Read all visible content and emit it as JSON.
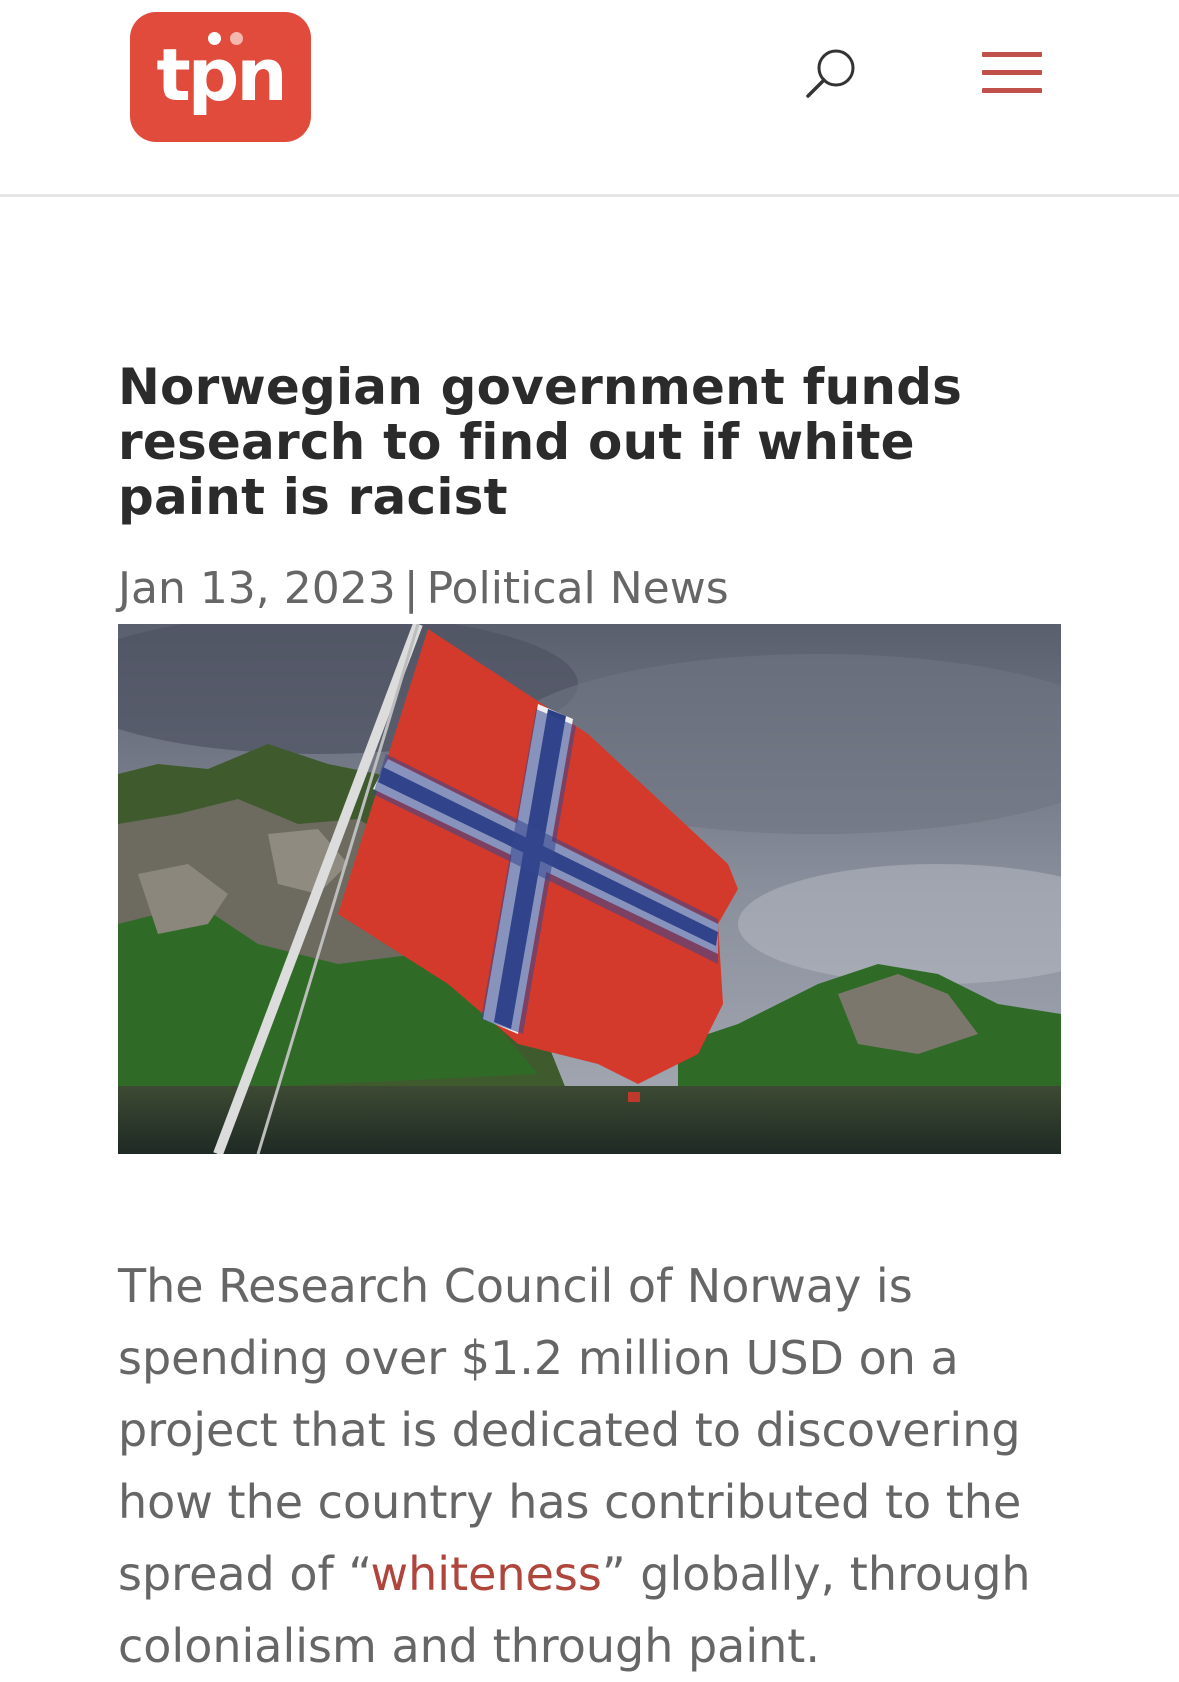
{
  "header": {
    "logo_text": "tpn",
    "search_icon": "search-icon",
    "menu_icon": "hamburger-menu-icon",
    "accent_color": "#e04b3c"
  },
  "article": {
    "title": "Norwegian government funds research to find out if white paint is racist",
    "date": "Jan 13, 2023",
    "separator": "|",
    "category": "Political News",
    "body_before_link": "The Research Council of Norway is spending over $1.2 million USD on a project that is dedicated to discovering how the country has contributed to the spread of “",
    "link_text": "whiteness",
    "body_after_link": "” globally, through colonialism and through paint.",
    "link_color": "#b0453b"
  }
}
